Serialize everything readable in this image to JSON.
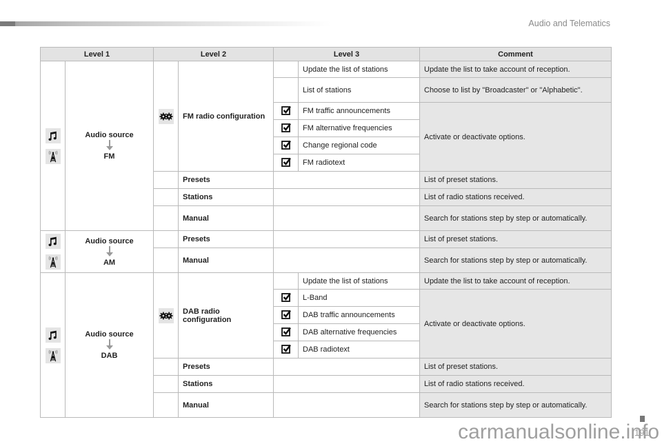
{
  "header": {
    "section_title": "Audio and Telematics"
  },
  "table": {
    "columns": [
      "Level 1",
      "Level 2",
      "Level 3",
      "Comment"
    ],
    "groups": [
      {
        "level1": {
          "title": "Audio source",
          "source": "FM",
          "icons": [
            "music-note-icon",
            "radio-tower-icon"
          ]
        },
        "config": {
          "icon": "gears-icon",
          "title": "FM radio configuration",
          "items": [
            {
              "checkbox": false,
              "label": "Update the list of stations",
              "comment": "Update the list to take account of reception."
            },
            {
              "checkbox": false,
              "label": "List of stations",
              "comment": "Choose to list by \"Broadcaster\" or \"Alphabetic\"."
            },
            {
              "checkbox": true,
              "label": "FM traffic announcements"
            },
            {
              "checkbox": true,
              "label": "FM alternative frequencies"
            },
            {
              "checkbox": true,
              "label": "Change regional code"
            },
            {
              "checkbox": true,
              "label": "FM radiotext"
            }
          ],
          "options_comment": "Activate or deactivate options."
        },
        "rows": [
          {
            "label": "Presets",
            "comment": "List of preset stations."
          },
          {
            "label": "Stations",
            "comment": "List of radio stations received."
          },
          {
            "label": "Manual",
            "comment": "Search for stations step by step or automatically."
          }
        ]
      },
      {
        "level1": {
          "title": "Audio source",
          "source": "AM",
          "icons": [
            "music-note-icon",
            "radio-tower-icon"
          ]
        },
        "rows": [
          {
            "label": "Presets",
            "comment": "List of preset stations."
          },
          {
            "label": "Manual",
            "comment": "Search for stations step by step or automatically."
          }
        ]
      },
      {
        "level1": {
          "title": "Audio source",
          "source": "DAB",
          "icons": [
            "music-note-icon",
            "radio-tower-icon"
          ]
        },
        "config": {
          "icon": "gears-icon",
          "title": "DAB radio configuration",
          "items": [
            {
              "checkbox": false,
              "label": "Update the list of stations",
              "comment": "Update the list to take account of reception."
            },
            {
              "checkbox": true,
              "label": "L-Band"
            },
            {
              "checkbox": true,
              "label": "DAB traffic announcements"
            },
            {
              "checkbox": true,
              "label": "DAB alternative frequencies"
            },
            {
              "checkbox": true,
              "label": "DAB radiotext"
            }
          ],
          "options_comment": "Activate or deactivate options."
        },
        "rows": [
          {
            "label": "Presets",
            "comment": "List of preset stations."
          },
          {
            "label": "Stations",
            "comment": "List of radio stations received."
          },
          {
            "label": "Manual",
            "comment": "Search for stations step by step or automatically."
          }
        ]
      }
    ]
  },
  "footer": {
    "page_number": "191",
    "watermark": "carmanualsonline.info"
  }
}
